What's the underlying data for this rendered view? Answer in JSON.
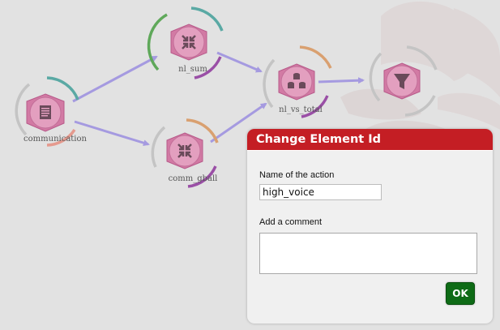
{
  "canvas": {
    "nodes": [
      {
        "id": "communication",
        "label": "communication",
        "icon": "document-icon"
      },
      {
        "id": "nl_sum",
        "label": "nl_sum",
        "icon": "compress-icon"
      },
      {
        "id": "comm_gball",
        "label": "comm_gball",
        "icon": "compress-icon"
      },
      {
        "id": "nl_vs_total",
        "label": "nl_vs_total",
        "icon": "database-icon"
      },
      {
        "id": "high_voice",
        "label": "",
        "icon": "filter-icon"
      }
    ],
    "edges": [
      {
        "from": "communication",
        "to": "nl_sum"
      },
      {
        "from": "communication",
        "to": "comm_gball"
      },
      {
        "from": "nl_sum",
        "to": "nl_vs_total"
      },
      {
        "from": "comm_gball",
        "to": "nl_vs_total"
      },
      {
        "from": "nl_vs_total",
        "to": "high_voice"
      }
    ]
  },
  "dialog": {
    "title": "Change Element Id",
    "name_label": "Name of the action",
    "name_value": "high_voice",
    "comment_label": "Add a comment",
    "comment_value": "",
    "ok_label": "OK"
  },
  "colors": {
    "header_red": "#c41e24",
    "ok_green": "#0e6b16",
    "node_pink": "#d27aa4",
    "edge_lavender": "#a59ae0",
    "arc_teal": "#5aa9a4",
    "arc_green": "#5fa85a",
    "arc_orange": "#d9a070",
    "arc_purple": "#9a4fa6",
    "arc_salmon": "#e59a8e",
    "arc_gray": "#c4c4c4"
  }
}
